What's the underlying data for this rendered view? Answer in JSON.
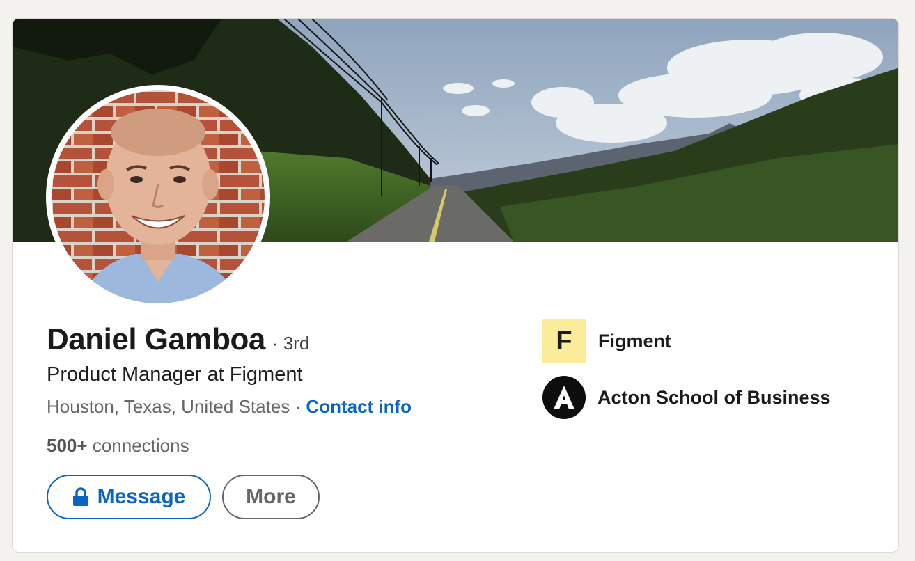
{
  "profile": {
    "name": "Daniel Gamboa",
    "degree": "· 3rd",
    "headline": "Product Manager at Figment",
    "location": "Houston, Texas, United States",
    "separator": "·",
    "contact_link": "Contact info",
    "connections_count": "500+",
    "connections_label": "connections"
  },
  "actions": {
    "message_label": "Message",
    "more_label": "More"
  },
  "organizations": [
    {
      "name": "Figment",
      "logo_letter": "F",
      "logo_color": "#fbec9a"
    },
    {
      "name": "Acton School of Business",
      "logo_letter": "A",
      "logo_color": "#0d0d0d"
    }
  ],
  "colors": {
    "link": "#0a66c2",
    "background": "#f3f2ef",
    "muted_text": "#666666"
  },
  "icons": {
    "message_button": "lock-icon"
  }
}
